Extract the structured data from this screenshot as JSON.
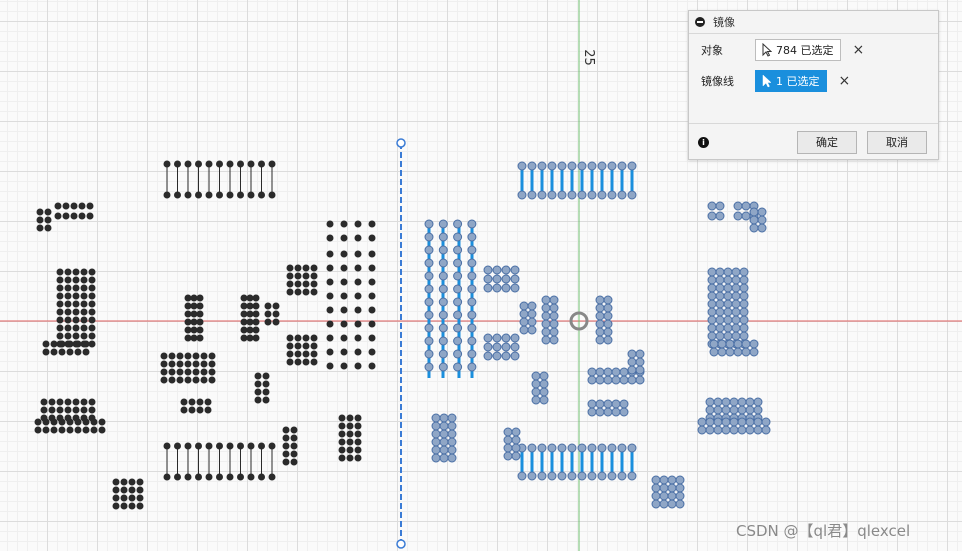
{
  "axis_label": "25",
  "panel": {
    "title": "镜像",
    "object_label": "对象",
    "object_selection": "784 已选定",
    "mirror_line_label": "镜像线",
    "mirror_line_selection": "1 已选定",
    "clear_icon": "×",
    "info_icon": "i",
    "ok_label": "确定",
    "cancel_label": "取消"
  },
  "watermark": "CSDN @【ql君】qlexcel",
  "colors": {
    "selected_dot": "#8fa6c6",
    "unselected_dot": "#2b2b2b",
    "highlight": "#1a8fdd",
    "red_axis": "#e06060",
    "green_axis": "#70c070"
  },
  "icons": [
    "collapse-icon",
    "cursor-icon",
    "clear-icon",
    "info-icon"
  ]
}
